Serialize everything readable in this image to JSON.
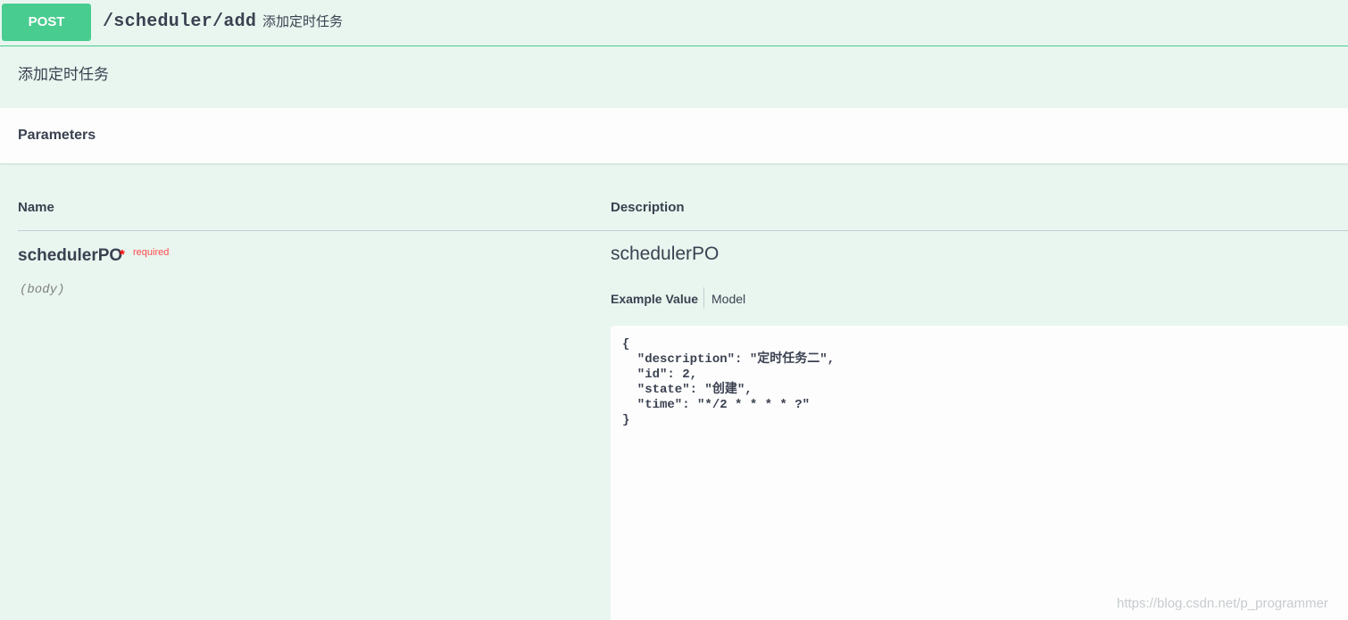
{
  "operation": {
    "method": "POST",
    "path": "/scheduler/add",
    "summary": "添加定时任务",
    "description": "添加定时任务"
  },
  "parameters_section": {
    "title": "Parameters",
    "columns": {
      "name": "Name",
      "description": "Description"
    },
    "param": {
      "name": "schedulerPO",
      "star": "*",
      "required_label": "required",
      "in": "(body)",
      "description_title": "schedulerPO",
      "tabs": {
        "example_value": "Example Value",
        "model": "Model"
      },
      "example_code": "{\n  \"description\": \"定时任务二\",\n  \"id\": 2,\n  \"state\": \"创建\",\n  \"time\": \"*/2 * * * * ?\"\n}"
    }
  },
  "watermark": "https://blog.csdn.net/p_programmer",
  "colors": {
    "post_green": "#49cc90",
    "background": "#e8f6ef",
    "required_red": "#ff0000"
  }
}
